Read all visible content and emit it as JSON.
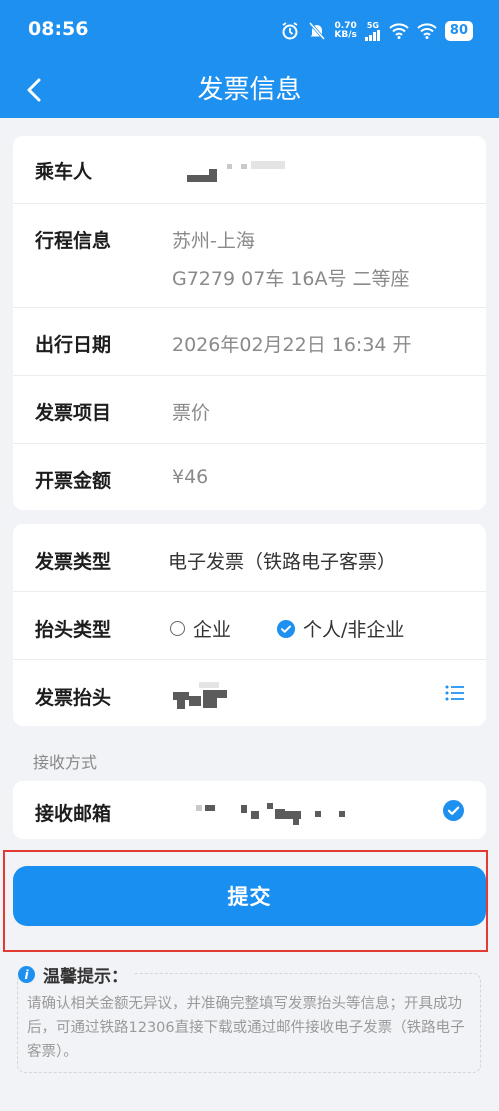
{
  "status_bar": {
    "time": "08:56",
    "net_speed_value": "0.70",
    "net_speed_unit": "KB/s",
    "network": "5G",
    "battery": "80"
  },
  "nav": {
    "title": "发票信息"
  },
  "trip_card": {
    "passenger_label": "乘车人",
    "itinerary_label": "行程信息",
    "itinerary_route": "苏州-上海",
    "itinerary_seat": "G7279 07车 16A号 二等座",
    "date_label": "出行日期",
    "date_value": "2026年02月22日 16:34 开",
    "item_label": "发票项目",
    "item_value": "票价",
    "amount_label": "开票金额",
    "amount_value": "¥46"
  },
  "invoice_card": {
    "type_label": "发票类型",
    "type_value": "电子发票（铁路电子客票）",
    "header_type_label": "抬头类型",
    "option_company": "企业",
    "option_personal": "个人/非企业",
    "selected_option": "个人/非企业",
    "header_label": "发票抬头"
  },
  "receive": {
    "caption": "接收方式",
    "email_label": "接收邮箱"
  },
  "submit_label": "提交",
  "tips": {
    "title": "温馨提示：",
    "body": "请确认相关金额无异议，并准确完整填写发票抬头等信息；开具成功后，可通过铁路12306直接下载或通过邮件接收电子发票（铁路电子客票）。"
  },
  "colors": {
    "primary": "#1e90f0",
    "highlight_border": "#e33a32",
    "page_bg": "#f2f3f6"
  }
}
